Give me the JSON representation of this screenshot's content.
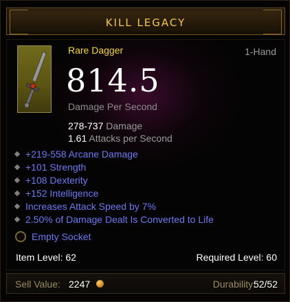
{
  "header": {
    "title": "KILL LEGACY"
  },
  "item": {
    "type": "Rare Dagger",
    "slot": "1-Hand",
    "dps": "814.5",
    "dps_label": "Damage Per Second",
    "damage_range": "278-737",
    "damage_label": "Damage",
    "attack_speed": "1.61",
    "attack_speed_label": "Attacks per Second",
    "image_icon": "dagger-icon"
  },
  "affixes": [
    "+219-558 Arcane Damage",
    "+101 Strength",
    "+108 Dexterity",
    "+152 Intelligence",
    "Increases Attack Speed by 7%",
    "2.50% of Damage Dealt Is Converted to Life"
  ],
  "socket": {
    "label": "Empty Socket",
    "icon": "empty-socket-icon"
  },
  "levels": {
    "item_level_label": "Item Level:",
    "item_level": "62",
    "required_level_label": "Required Level:",
    "required_level": "60"
  },
  "footer": {
    "sell_label": "Sell Value:",
    "sell_value": "2247",
    "coin_icon": "gold-coin-icon",
    "durability_label": "Durability:",
    "durability_value": "52/52"
  },
  "colors": {
    "title": "#f3c64d",
    "rare_yellow": "#f5d842",
    "magic_blue": "#6e78f2",
    "gray_text": "#9a9a9a",
    "dps_glow": "#7a1560"
  }
}
